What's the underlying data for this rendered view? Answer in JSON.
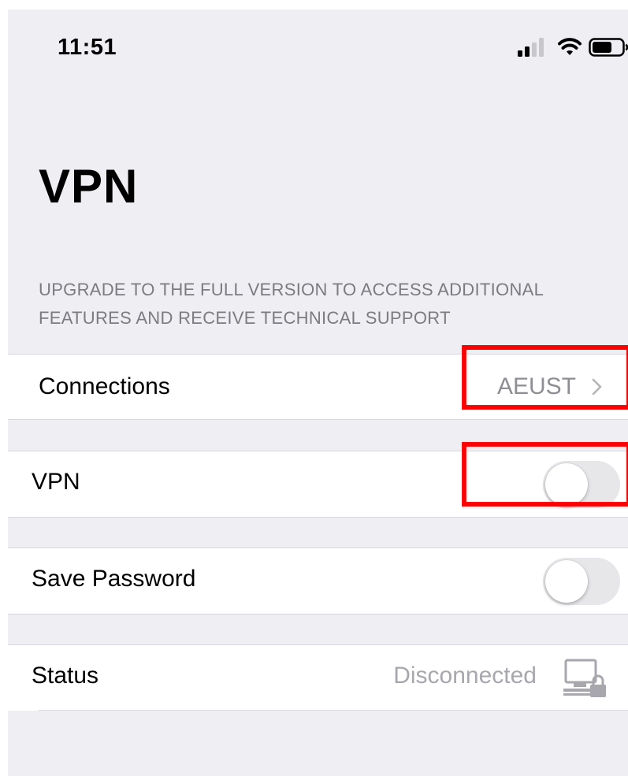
{
  "status_bar": {
    "time": "11:51",
    "icons": [
      "signal-icon",
      "wifi-icon",
      "battery-icon"
    ]
  },
  "page": {
    "title": "VPN",
    "upgrade_line1": "UPGRADE TO THE FULL VERSION TO ACCESS ADDITIONAL",
    "upgrade_line2": "FEATURES AND RECEIVE TECHNICAL SUPPORT"
  },
  "cells": {
    "connections": {
      "label": "Connections",
      "value": "AEUST",
      "icon": "chevron-right-icon"
    },
    "vpn": {
      "label": "VPN",
      "enabled": false
    },
    "save_password": {
      "label": "Save Password",
      "enabled": false
    },
    "status": {
      "label": "Status",
      "value": "Disconnected",
      "icon": "network-lock-icon"
    }
  },
  "colors": {
    "background": "#eeeef3",
    "secondary_text": "#8e8e93",
    "highlight": "#ff0000",
    "toggle_off": "#e7e7ea"
  }
}
